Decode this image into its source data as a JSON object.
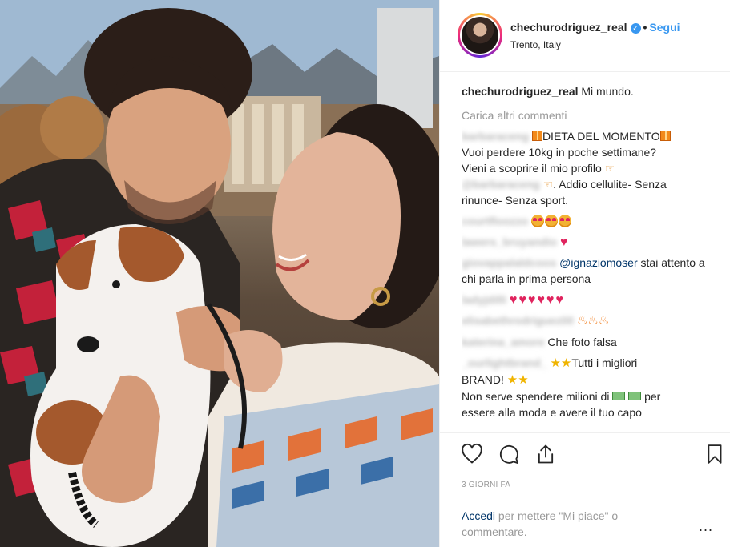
{
  "post": {
    "username": "chechurodriguez_real",
    "verified_icon": "verified-badge-icon",
    "separator": "•",
    "follow_label": "Segui",
    "location": "Trento, Italy",
    "caption_user": "chechurodriguez_real",
    "caption_text": "Mi mundo.",
    "load_more": "Carica altri commenti",
    "date": "3 GIORNI FA"
  },
  "comments": [
    {
      "user": "barbaraceng",
      "line1": "DIETA DEL MOMENTO",
      "line2": "Vuoi perdere 10kg in poche settimane?",
      "line3": "Vieni a scoprire il mio profilo",
      "line4_user": "@barbaraceng",
      "line4": ". Addio cellulite- Senza",
      "line5": "rinunce- Senza sport."
    },
    {
      "user": "courtfloozzo"
    },
    {
      "user": "lawers_bruyandio"
    },
    {
      "user": "giovappalaldcoos",
      "mention": "@ignaziomoser",
      "text": "stai attento a chi parla in prima persona"
    },
    {
      "user": "ladyjdilli"
    },
    {
      "user": "elisabethrodriguez00"
    },
    {
      "user": "katerina_amore",
      "text": "Che foto falsa"
    },
    {
      "user": "_ourlightbrand_",
      "text1": "Tutti i migliori",
      "text2": "BRAND!",
      "text3": "Non serve spendere milioni di",
      "text4": "per",
      "text5": "essere alla moda e avere il tuo capo"
    }
  ],
  "actions": {
    "like_icon": "heart-icon",
    "comment_icon": "comment-icon",
    "share_icon": "share-icon",
    "save_icon": "bookmark-icon"
  },
  "footer": {
    "login_link": "Accedi",
    "login_text": "per mettere \"Mi piace\" o commentare.",
    "more_label": "..."
  },
  "colors": {
    "link_blue": "#3897f0",
    "text": "#262626",
    "muted": "#999999",
    "mention": "#003569",
    "border": "#efefef"
  }
}
